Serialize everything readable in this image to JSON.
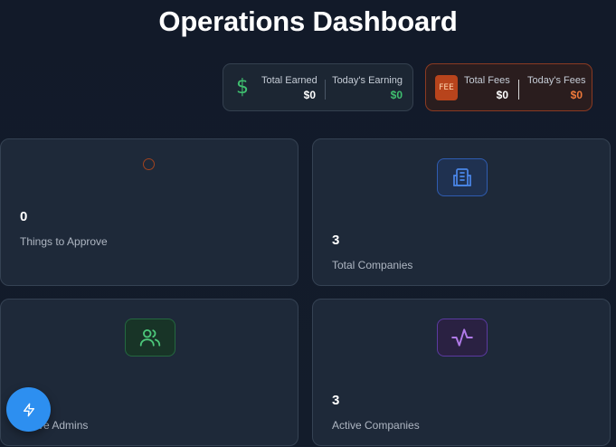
{
  "page": {
    "title": "Operations Dashboard"
  },
  "earnings": {
    "icon": "dollar-icon",
    "dollar_glyph": "$",
    "total_label": "Total Earned",
    "total_value": "$0",
    "today_label": "Today's Earning",
    "today_value": "$0",
    "accent": "#3fbf6f"
  },
  "fees": {
    "icon": "fee-icon",
    "badge_text": "FEE",
    "total_label": "Total Fees",
    "total_value": "$0",
    "today_label": "Today's Fees",
    "today_value": "$0",
    "accent": "#f07a3a"
  },
  "cards": [
    {
      "id": "approve",
      "value": "0",
      "label": "Things to Approve",
      "icon": "loading-spinner-icon",
      "accent": "#a0431f"
    },
    {
      "id": "companies",
      "value": "3",
      "label": "Total Companies",
      "icon": "building-icon",
      "accent": "#4a86e8"
    },
    {
      "id": "admins",
      "value": "",
      "label": "Active Admins",
      "icon": "users-icon",
      "accent": "#4cc77a"
    },
    {
      "id": "active-companies",
      "value": "3",
      "label": "Active Companies",
      "icon": "activity-icon",
      "accent": "#b07ae8"
    }
  ],
  "fab": {
    "icon": "lightning-icon",
    "color": "#2d8ff0"
  }
}
